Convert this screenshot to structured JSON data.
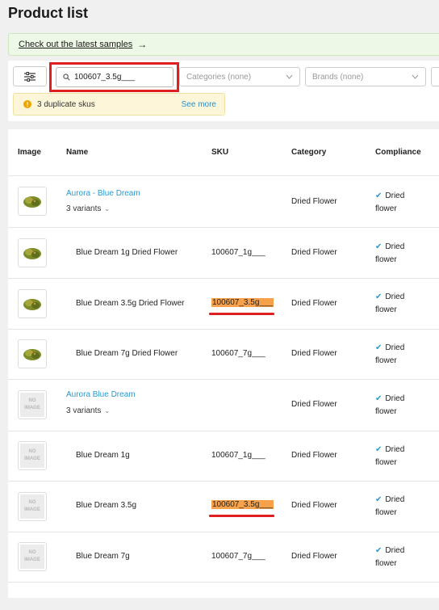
{
  "page": {
    "title": "Product list"
  },
  "banner": {
    "link_text": "Check out the latest samples",
    "arrow": "→"
  },
  "filters": {
    "search_value": "100607_3.5g___",
    "categories_placeholder": "Categories (none)",
    "brands_placeholder": "Brands (none)"
  },
  "duplicate_notice": {
    "text": "3 duplicate skus",
    "link": "See more",
    "icon": "!"
  },
  "table": {
    "columns": {
      "image": "Image",
      "name": "Name",
      "sku": "SKU",
      "category": "Category",
      "compliance": "Compliance"
    },
    "no_image_line1": "NO",
    "no_image_line2": "IMAGE",
    "rows": [
      {
        "name": "Aurora - Blue Dream",
        "variants": "3 variants",
        "sku": "",
        "category": "Dried Flower",
        "compliance_line1": "Dried",
        "compliance_line2": "flower"
      },
      {
        "name": "Blue Dream 1g Dried Flower",
        "sku": "100607_1g___",
        "category": "Dried Flower",
        "compliance_line1": "Dried",
        "compliance_line2": "flower"
      },
      {
        "name": "Blue Dream 3.5g Dried Flower",
        "sku": "100607_3.5g___",
        "category": "Dried Flower",
        "compliance_line1": "Dried",
        "compliance_line2": "flower"
      },
      {
        "name": "Blue Dream 7g Dried Flower",
        "sku": "100607_7g___",
        "category": "Dried Flower",
        "compliance_line1": "Dried",
        "compliance_line2": "flower"
      },
      {
        "name": "Aurora Blue Dream",
        "variants": "3 variants",
        "sku": "",
        "category": "Dried Flower",
        "compliance_line1": "Dried",
        "compliance_line2": "flower"
      },
      {
        "name": "Blue Dream 1g",
        "sku": "100607_1g___",
        "category": "Dried Flower",
        "compliance_line1": "Dried",
        "compliance_line2": "flower"
      },
      {
        "name": "Blue Dream 3.5g",
        "sku": "100607_3.5g___",
        "category": "Dried Flower",
        "compliance_line1": "Dried",
        "compliance_line2": "flower"
      },
      {
        "name": "Blue Dream 7g",
        "sku": "100607_7g___",
        "category": "Dried Flower",
        "compliance_line1": "Dried",
        "compliance_line2": "flower"
      }
    ]
  },
  "colors": {
    "link": "#2b9ad0",
    "highlight": "#f7a24a",
    "annotation": "#e02020"
  }
}
